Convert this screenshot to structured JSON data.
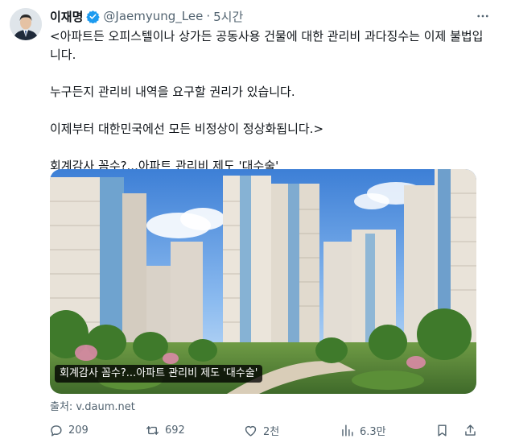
{
  "author": {
    "name": "이재명",
    "handle": "@Jaemyung_Lee",
    "separator": "·",
    "time": "5시간"
  },
  "tweet": {
    "lines": [
      "<아파트든 오피스텔이나 상가든 공동사용 건물에 대한 관리비 과다징수는 이제 불법입니다.",
      "누구든지 관리비 내역을 요구할 권리가 있습니다.",
      "이제부터 대한민국에선 모든 비정상이 정상화됩니다.>",
      "회계감사 꼼수?...아파트 관리비 제도 '대수술'"
    ]
  },
  "card": {
    "caption": "회계감사 꼼수?...아파트 관리비 제도 '대수술'",
    "source": "출처: v.daum.net"
  },
  "actions": {
    "replies": "209",
    "reposts": "692",
    "likes": "2천",
    "views": "6.3만"
  },
  "colors": {
    "text": "#0f1419",
    "secondary": "#536471",
    "verified": "#1d9bf0"
  },
  "icons": [
    "verified-badge-icon",
    "more-icon",
    "reply-icon",
    "repost-icon",
    "like-icon",
    "views-icon",
    "bookmark-icon",
    "share-icon"
  ]
}
